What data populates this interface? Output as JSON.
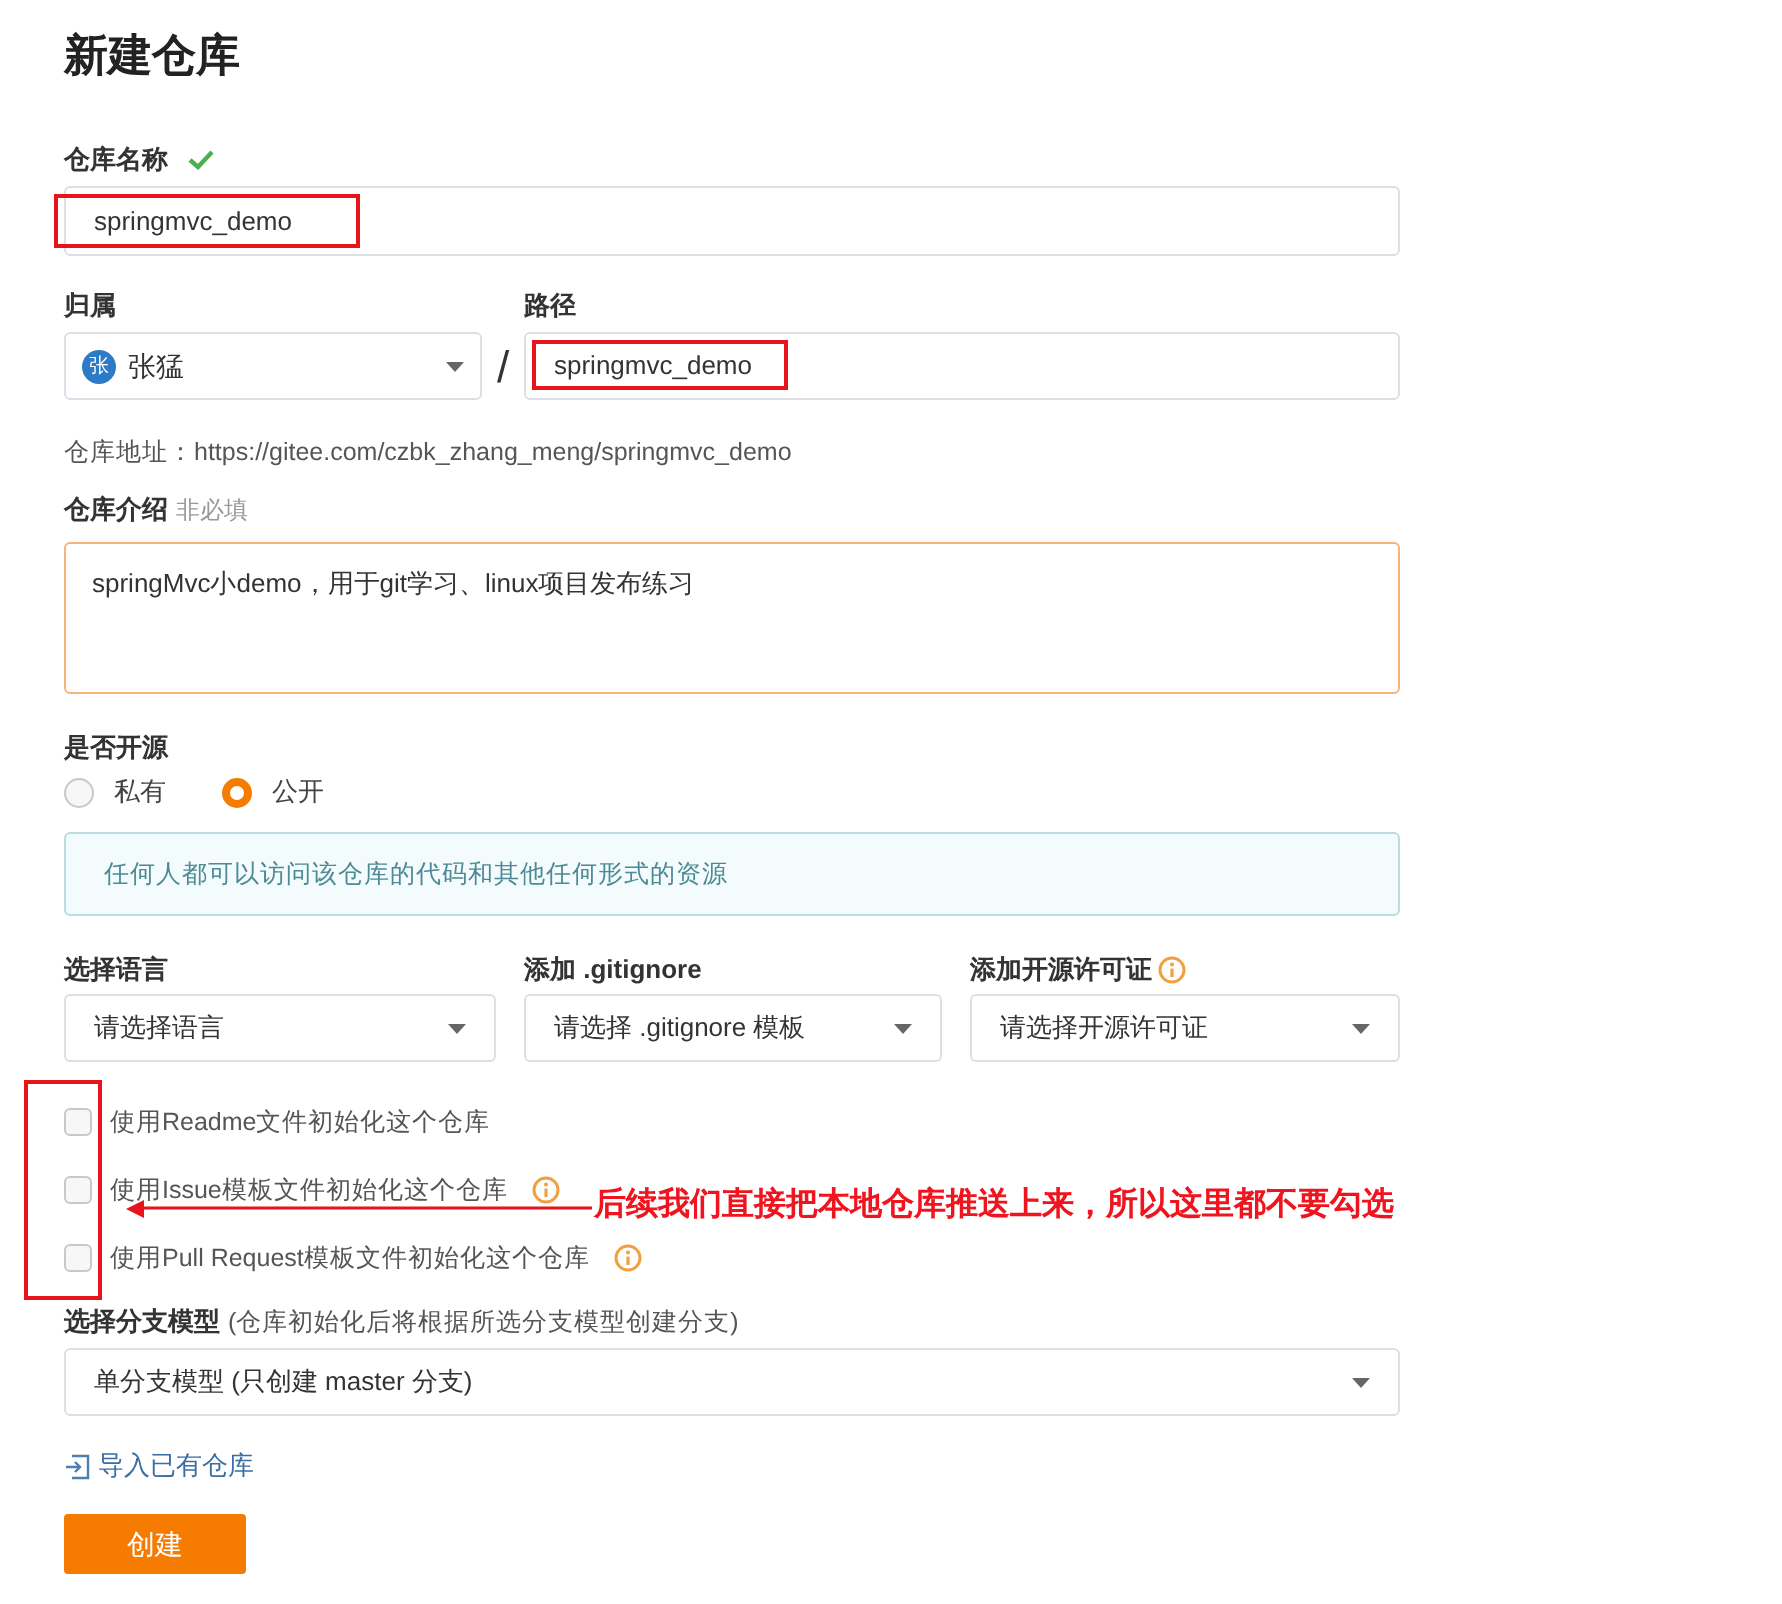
{
  "page_title": "新建仓库",
  "name_field": {
    "label": "仓库名称",
    "valid": true,
    "value": "springmvc_demo"
  },
  "owner": {
    "label": "归属",
    "avatar": "张",
    "value": "张猛"
  },
  "separator": "/",
  "path": {
    "label": "路径",
    "value": "springmvc_demo"
  },
  "address": "仓库地址：https://gitee.com/czbk_zhang_meng/springmvc_demo",
  "description": {
    "label": "仓库介绍",
    "hint": "非必填",
    "value": "springMvc小demo，用于git学习、linux项目发布练习"
  },
  "visibility": {
    "label": "是否开源",
    "options": [
      {
        "label": "私有",
        "selected": false
      },
      {
        "label": "公开",
        "selected": true
      }
    ],
    "notice": "任何人都可以访问该仓库的代码和其他任何形式的资源"
  },
  "selects": [
    {
      "label": "选择语言",
      "info": false,
      "value": "请选择语言"
    },
    {
      "label": "添加 .gitignore",
      "info": false,
      "value": "请选择 .gitignore 模板"
    },
    {
      "label": "添加开源许可证",
      "info": true,
      "value": "请选择开源许可证"
    }
  ],
  "init_options": [
    {
      "label": "使用Readme文件初始化这个仓库",
      "checked": false,
      "info": false
    },
    {
      "label": "使用Issue模板文件初始化这个仓库",
      "checked": false,
      "info": true
    },
    {
      "label": "使用Pull Request模板文件初始化这个仓库",
      "checked": false,
      "info": true
    }
  ],
  "branch_model": {
    "label": "选择分支模型",
    "note": "(仓库初始化后将根据所选分支模型创建分支)",
    "value": "单分支模型 (只创建 master 分支)"
  },
  "import_link": "导入已有仓库",
  "create_button": "创建",
  "annotation": "后续我们直接把本地仓库推送上来，所以这里都不要勾选"
}
